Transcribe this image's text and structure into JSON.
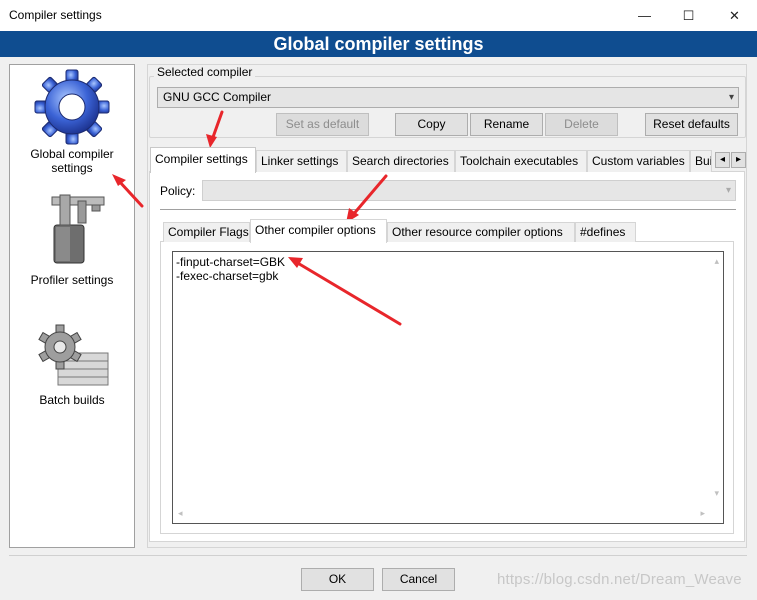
{
  "window": {
    "title": "Compiler settings",
    "minimize_glyph": "—",
    "maximize_glyph": "☐",
    "close_glyph": "✕"
  },
  "banner": {
    "title": "Global compiler settings"
  },
  "sidebar": {
    "items": [
      {
        "label_line1": "Global compiler",
        "label_line2": "settings",
        "icon": "gear-icon"
      },
      {
        "label_line1": "Profiler settings",
        "label_line2": "",
        "icon": "caliper-icon"
      },
      {
        "label_line1": "Batch builds",
        "label_line2": "",
        "icon": "gear-stack-icon"
      }
    ]
  },
  "compiler_group": {
    "label": "Selected compiler",
    "selected": "GNU GCC Compiler",
    "buttons": {
      "set_default": "Set as default",
      "copy": "Copy",
      "rename": "Rename",
      "delete": "Delete",
      "reset_defaults": "Reset defaults"
    }
  },
  "tabs": {
    "compiler_settings": "Compiler settings",
    "linker_settings": "Linker settings",
    "search_directories": "Search directories",
    "toolchain_executables": "Toolchain executables",
    "custom_variables": "Custom variables",
    "build_options_partial": "Bui",
    "scroll_left": "◂",
    "scroll_right": "▸"
  },
  "policy": {
    "label": "Policy:",
    "value": ""
  },
  "subtabs": {
    "compiler_flags": "Compiler Flags",
    "other_compiler_options": "Other compiler options",
    "other_resource_compiler_options": "Other resource compiler options",
    "defines": "#defines"
  },
  "editor": {
    "lines": [
      "-finput-charset=GBK",
      "-fexec-charset=gbk"
    ]
  },
  "footer": {
    "ok": "OK",
    "cancel": "Cancel"
  },
  "watermark": "https://blog.csdn.net/Dream_Weave",
  "colors": {
    "banner": "#0f4d90",
    "annotation": "#e8262b"
  }
}
